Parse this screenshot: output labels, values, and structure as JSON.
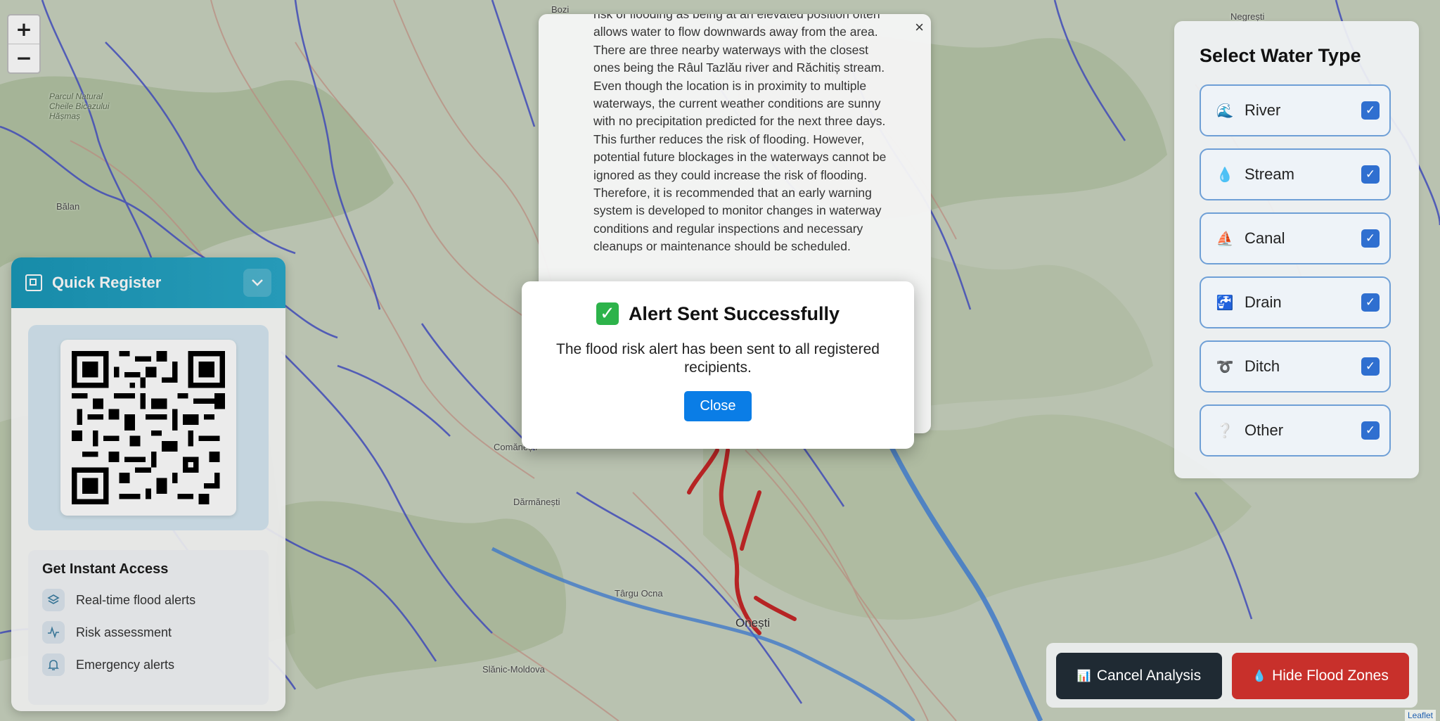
{
  "map": {
    "zoom_in": "+",
    "zoom_out": "−",
    "towns": [
      "Parcul Natural Cheile Bicazului Hășmaș",
      "Bălan",
      "Comănești",
      "Dărmănești",
      "Târgu Ocna",
      "Onești",
      "Slănic-Moldova",
      "Bozi",
      "Negrești"
    ],
    "attribution": "Leaflet"
  },
  "quick_register": {
    "title": "Quick Register",
    "access_title": "Get Instant Access",
    "features": [
      "Real-time flood alerts",
      "Risk assessment",
      "Emergency alerts"
    ]
  },
  "description": {
    "close": "×",
    "text": "risk of flooding as being at an elevated position often allows water to flow downwards away from the area. There are three nearby waterways with the closest ones being the Râul Tazlău river and Răchitiș stream. Even though the location is in proximity to multiple waterways, the current weather conditions are sunny with no precipitation predicted for the next three days. This further reduces the risk of flooding. However, potential future blockages in the waterways cannot be ignored as they could increase the risk of flooding. Therefore, it is recommended that an early warning system is developed to monitor changes in waterway conditions and regular inspections and necessary cleanups or maintenance should be scheduled."
  },
  "modal": {
    "title": "Alert Sent Successfully",
    "message": "The flood risk alert has been sent to all registered recipients.",
    "close_label": "Close"
  },
  "water_types": {
    "title": "Select Water Type",
    "items": [
      {
        "label": "River",
        "icon": "🌊",
        "checked": true
      },
      {
        "label": "Stream",
        "icon": "💧",
        "checked": true
      },
      {
        "label": "Canal",
        "icon": "⛵",
        "checked": true
      },
      {
        "label": "Drain",
        "icon": "🚰",
        "checked": true
      },
      {
        "label": "Ditch",
        "icon": "➰",
        "checked": true
      },
      {
        "label": "Other",
        "icon": "❔",
        "checked": true
      }
    ]
  },
  "actions": {
    "cancel_label": "Cancel Analysis",
    "hide_label": "Hide Flood Zones"
  },
  "colors": {
    "accent": "#0a7de6",
    "danger": "#c8302b",
    "header": "#1a98b8",
    "river": "#3b4cc6",
    "flood": "#c62828"
  }
}
